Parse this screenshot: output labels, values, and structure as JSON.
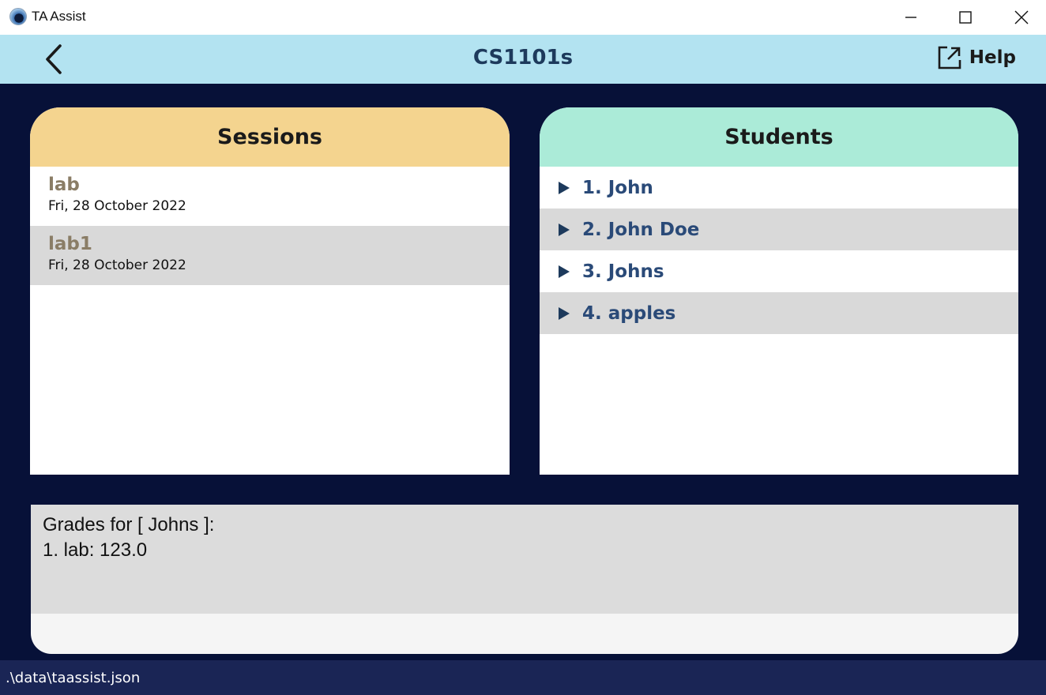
{
  "window": {
    "title": "TA Assist"
  },
  "header": {
    "title": "CS1101s",
    "help_label": "Help"
  },
  "sessions": {
    "title": "Sessions",
    "items": [
      {
        "name": "lab",
        "date": "Fri, 28 October 2022"
      },
      {
        "name": "lab1",
        "date": "Fri, 28 October 2022"
      }
    ]
  },
  "students": {
    "title": "Students",
    "items": [
      {
        "label": "1. John"
      },
      {
        "label": "2. John Doe"
      },
      {
        "label": "3. Johns"
      },
      {
        "label": "4. apples"
      }
    ]
  },
  "result": {
    "line1": "Grades for [ Johns ]:",
    "line2": "1. lab: 123.0"
  },
  "status": {
    "path": ".\\data\\taassist.json"
  },
  "colors": {
    "background": "#071138",
    "header": "#b3e3f1",
    "sessions_header": "#f4d48f",
    "students_header": "#abebd8",
    "session_name": "#8a7d66",
    "student_name": "#2a4a78"
  }
}
